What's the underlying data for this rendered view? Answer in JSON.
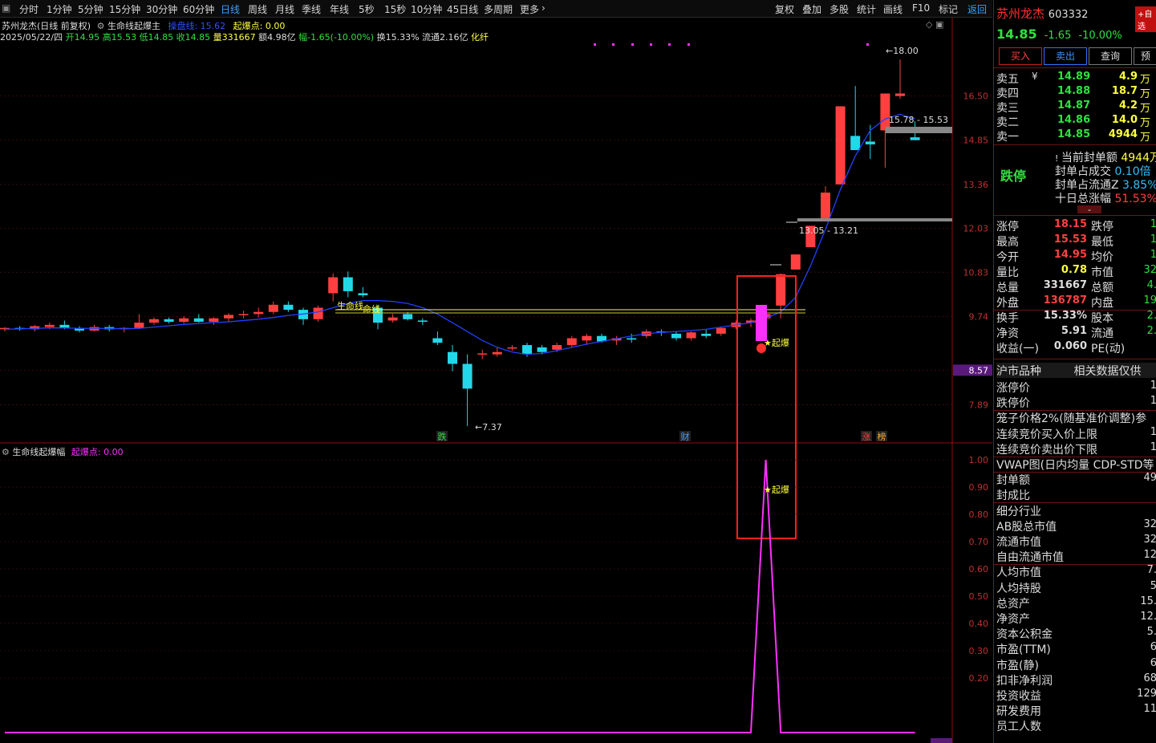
{
  "toolbar": {
    "periods": [
      "分时",
      "1分钟",
      "5分钟",
      "15分钟",
      "30分钟",
      "60分钟",
      "日线",
      "周线",
      "月线",
      "季线",
      "年线",
      "5秒",
      "15秒",
      "10分钟",
      "45日线",
      "多周期",
      "更多"
    ],
    "active": "日线",
    "right_buttons": [
      "复权",
      "叠加",
      "多股",
      "统计",
      "画线",
      "F10",
      "标记",
      "返回"
    ]
  },
  "chart_header": {
    "title": "苏州龙杰(日线 前复权)",
    "indicator": "生命线起爆主",
    "line_label": "操盘线: 15.62",
    "signal_label": "起爆点: 0.00"
  },
  "ohlc_line": {
    "date": "2025/05/22/四",
    "open": "开14.95",
    "high": "高15.53",
    "low": "低14.85",
    "close": "收14.85",
    "volume": "量331667",
    "amount": "额4.98亿",
    "change": "幅-1.65(-10.00%)",
    "turnover": "换15.33%",
    "float": "流通2.16亿",
    "sector": "化纤"
  },
  "price_axis": [
    "16.50",
    "14.85",
    "13.36",
    "12.03",
    "10.83",
    "9.74",
    "8.57",
    "7.89"
  ],
  "annotations": {
    "high_label": "18.00",
    "low_label": "7.37",
    "upper_band": "15.78 - 15.53",
    "lower_band": "13.05 - 13.21",
    "lifeline_label": "生命线",
    "lifeline_label2": "命线",
    "star_main": "★起爆",
    "star_sub": "★起爆",
    "event_die": "跌",
    "event_cai": "财",
    "event_zhang": "涨",
    "event_bang": "榜"
  },
  "sub_chart": {
    "title": "生命线起爆幅",
    "signal_label": "起爆点: 0.00",
    "axis": [
      "1.00",
      "0.90",
      "0.80",
      "0.70",
      "0.60",
      "0.50",
      "0.40",
      "0.30",
      "0.20"
    ]
  },
  "colors": {
    "up": "#ff4040",
    "down": "#22d8e8",
    "ma": "#2040ff",
    "signal": "#ff30ff",
    "highlight": "#ff2020",
    "yellow": "#ffff40"
  },
  "side": {
    "name": "苏州龙杰",
    "code": "603332",
    "add_btn": "+自选",
    "price": "14.85",
    "change": "-1.65",
    "change_pct": "-10.00%",
    "buttons": [
      "买入",
      "卖出",
      "查询",
      "预"
    ],
    "order_book": [
      {
        "label": "卖五",
        "price": "14.89",
        "vol": "4.9",
        "unit": "万"
      },
      {
        "label": "卖四",
        "price": "14.88",
        "vol": "18.7",
        "unit": "万"
      },
      {
        "label": "卖三",
        "price": "14.87",
        "vol": "4.2",
        "unit": "万"
      },
      {
        "label": "卖二",
        "price": "14.86",
        "vol": "14.0",
        "unit": "万"
      },
      {
        "label": "卖一",
        "price": "14.85",
        "vol": "4944",
        "unit": "万"
      }
    ],
    "limit_status": "跌停",
    "seal": [
      {
        "label": "当前封单额",
        "value": "4944万"
      },
      {
        "label": "封单占成交",
        "value": "0.10倍"
      },
      {
        "label": "封单占流通Z",
        "value": "3.85%"
      },
      {
        "label": "十日总涨幅",
        "value": "51.53%"
      }
    ],
    "quote": [
      {
        "l1": "涨停",
        "v1": "18.15",
        "l2": "跌停",
        "v2": "1"
      },
      {
        "l1": "最高",
        "v1": "15.53",
        "l2": "最低",
        "v2": "1"
      },
      {
        "l1": "今开",
        "v1": "14.95",
        "l2": "均价",
        "v2": "1"
      },
      {
        "l1": "量比",
        "v1": "0.78",
        "l2": "市值",
        "v2": "32"
      },
      {
        "l1": "总量",
        "v1": "331667",
        "l2": "总额",
        "v2": "4."
      },
      {
        "l1": "外盘",
        "v1": "136787",
        "l2": "内盘",
        "v2": "19"
      },
      {
        "l1": "换手",
        "v1": "15.33%",
        "l2": "股本",
        "v2": "2."
      },
      {
        "l1": "净资",
        "v1": "5.91",
        "l2": "流通",
        "v2": "2."
      },
      {
        "l1": "收益(一)",
        "v1": "0.060",
        "l2": "PE(动)",
        "v2": ""
      }
    ],
    "section_title": "沪市品种",
    "section_right": "相关数据仅供",
    "misc": [
      {
        "label": "涨停价",
        "value": "1"
      },
      {
        "label": "跌停价",
        "value": "1"
      },
      {
        "label": "笼子价格2%(随基准价调整)参",
        "value": ""
      },
      {
        "label": "连续竞价买入价上限",
        "value": "1"
      },
      {
        "label": "连续竞价卖出价下限",
        "value": "1"
      },
      {
        "label": "VWAP图(日内均量 CDP-STD等",
        "value": ""
      },
      {
        "label": "封单额",
        "value": "49"
      },
      {
        "label": "封成比",
        "value": ""
      },
      {
        "label": "细分行业",
        "value": ""
      },
      {
        "label": "AB股总市值",
        "value": "32"
      },
      {
        "label": "流通市值",
        "value": "32"
      },
      {
        "label": "自由流通市值",
        "value": "12"
      },
      {
        "label": "人均市值",
        "value": "7."
      },
      {
        "label": "人均持股",
        "value": "5"
      },
      {
        "label": "总资产",
        "value": "15."
      },
      {
        "label": "净资产",
        "value": "12."
      },
      {
        "label": "资本公积金",
        "value": "5."
      },
      {
        "label": "市盈(TTM)",
        "value": "6"
      },
      {
        "label": "市盈(静)",
        "value": "6"
      },
      {
        "label": "扣非净利润",
        "value": "68"
      },
      {
        "label": "投资收益",
        "value": "129"
      },
      {
        "label": "研发费用",
        "value": "11"
      },
      {
        "label": "员工人数",
        "value": ""
      }
    ]
  },
  "chart_data": {
    "type": "candlestick",
    "candles": [
      [
        9.45,
        9.5,
        9.4,
        9.48
      ],
      [
        9.48,
        9.52,
        9.42,
        9.45
      ],
      [
        9.45,
        9.55,
        9.4,
        9.52
      ],
      [
        9.5,
        9.6,
        9.45,
        9.55
      ],
      [
        9.55,
        9.65,
        9.45,
        9.48
      ],
      [
        9.48,
        9.52,
        9.38,
        9.42
      ],
      [
        9.42,
        9.55,
        9.4,
        9.5
      ],
      [
        9.5,
        9.55,
        9.4,
        9.45
      ],
      [
        9.45,
        9.5,
        9.38,
        9.48
      ],
      [
        9.48,
        9.8,
        9.45,
        9.6
      ],
      [
        9.6,
        9.72,
        9.55,
        9.68
      ],
      [
        9.68,
        9.72,
        9.58,
        9.62
      ],
      [
        9.62,
        9.75,
        9.58,
        9.7
      ],
      [
        9.7,
        9.8,
        9.6,
        9.62
      ],
      [
        9.62,
        9.72,
        9.55,
        9.7
      ],
      [
        9.7,
        9.82,
        9.62,
        9.78
      ],
      [
        9.78,
        9.88,
        9.7,
        9.8
      ],
      [
        9.8,
        9.95,
        9.72,
        9.85
      ],
      [
        9.85,
        10.1,
        9.8,
        10.02
      ],
      [
        10.02,
        10.1,
        9.85,
        9.9
      ],
      [
        9.9,
        9.95,
        9.55,
        9.68
      ],
      [
        9.68,
        10.0,
        9.62,
        9.95
      ],
      [
        10.3,
        10.8,
        10.1,
        10.7
      ],
      [
        10.7,
        10.85,
        10.2,
        10.35
      ],
      [
        10.3,
        10.45,
        10.2,
        10.25
      ],
      [
        9.95,
        10.0,
        9.45,
        9.6
      ],
      [
        9.65,
        9.8,
        9.6,
        9.72
      ],
      [
        9.8,
        9.85,
        9.65,
        9.68
      ],
      [
        9.65,
        9.7,
        9.55,
        9.62
      ],
      [
        9.25,
        9.4,
        9.1,
        9.15
      ],
      [
        8.95,
        9.1,
        8.55,
        8.7
      ],
      [
        8.7,
        8.9,
        7.5,
        8.2
      ],
      [
        8.9,
        9.0,
        8.8,
        8.92
      ],
      [
        8.9,
        9.05,
        8.85,
        8.95
      ],
      [
        9.05,
        9.1,
        8.98,
        9.05
      ],
      [
        9.1,
        9.15,
        8.85,
        8.9
      ],
      [
        9.05,
        9.1,
        8.9,
        8.95
      ],
      [
        9.0,
        9.15,
        8.95,
        9.1
      ],
      [
        9.1,
        9.3,
        9.05,
        9.25
      ],
      [
        9.2,
        9.35,
        9.1,
        9.3
      ],
      [
        9.3,
        9.35,
        9.15,
        9.18
      ],
      [
        9.2,
        9.3,
        9.1,
        9.25
      ],
      [
        9.25,
        9.35,
        9.15,
        9.22
      ],
      [
        9.3,
        9.45,
        9.25,
        9.4
      ],
      [
        9.4,
        9.45,
        9.3,
        9.38
      ],
      [
        9.35,
        9.4,
        9.2,
        9.25
      ],
      [
        9.25,
        9.4,
        9.2,
        9.38
      ],
      [
        9.35,
        9.45,
        9.25,
        9.3
      ],
      [
        9.35,
        9.5,
        9.3,
        9.48
      ],
      [
        9.5,
        9.65,
        9.45,
        9.6
      ],
      [
        9.6,
        9.7,
        9.5,
        9.65
      ],
      [
        9.7,
        9.85,
        9.6,
        9.8
      ],
      [
        10.0,
        10.8,
        9.7,
        10.78
      ],
      [
        10.9,
        11.1,
        11.0,
        11.3
      ],
      [
        11.5,
        12.1,
        11.5,
        12.1
      ],
      [
        12.3,
        13.3,
        12.6,
        13.1
      ],
      [
        13.36,
        15.6,
        14.3,
        16.1
      ],
      [
        15.0,
        16.9,
        14.8,
        14.5
      ],
      [
        14.8,
        15.4,
        14.2,
        14.7
      ],
      [
        15.2,
        16.6,
        13.9,
        16.6
      ],
      [
        16.5,
        18.0,
        16.4,
        16.6
      ],
      [
        14.95,
        15.53,
        14.85,
        14.85
      ]
    ],
    "ma": [
      9.45,
      9.46,
      9.47,
      9.48,
      9.48,
      9.47,
      9.47,
      9.47,
      9.46,
      9.47,
      9.5,
      9.53,
      9.56,
      9.58,
      9.6,
      9.62,
      9.65,
      9.68,
      9.72,
      9.77,
      9.8,
      9.85,
      9.95,
      10.05,
      10.12,
      10.12,
      10.1,
      10.05,
      9.95,
      9.8,
      9.6,
      9.4,
      9.2,
      9.05,
      8.95,
      8.9,
      8.92,
      8.98,
      9.05,
      9.12,
      9.18,
      9.24,
      9.3,
      9.35,
      9.38,
      9.4,
      9.42,
      9.45,
      9.5,
      9.55,
      9.6,
      9.7,
      9.85,
      10.2,
      11.0,
      12.0,
      13.2,
      14.3,
      15.2,
      15.62,
      15.8,
      15.62
    ],
    "signal": [
      0,
      0,
      0,
      0,
      0,
      0,
      0,
      0,
      0,
      0,
      0,
      0,
      0,
      0,
      0,
      0,
      0,
      0,
      0,
      0,
      0,
      0,
      0,
      0,
      0,
      0,
      0,
      0,
      0,
      0,
      0,
      0,
      0,
      0,
      0,
      0,
      0,
      0,
      0,
      0,
      0,
      0,
      0,
      0,
      0,
      0,
      0,
      0,
      0,
      0,
      0,
      1.0,
      0,
      0,
      0,
      0,
      0,
      0,
      0,
      0,
      0,
      0
    ],
    "price_range": [
      7.3,
      18.5
    ],
    "signal_range": [
      0,
      1.0
    ]
  }
}
